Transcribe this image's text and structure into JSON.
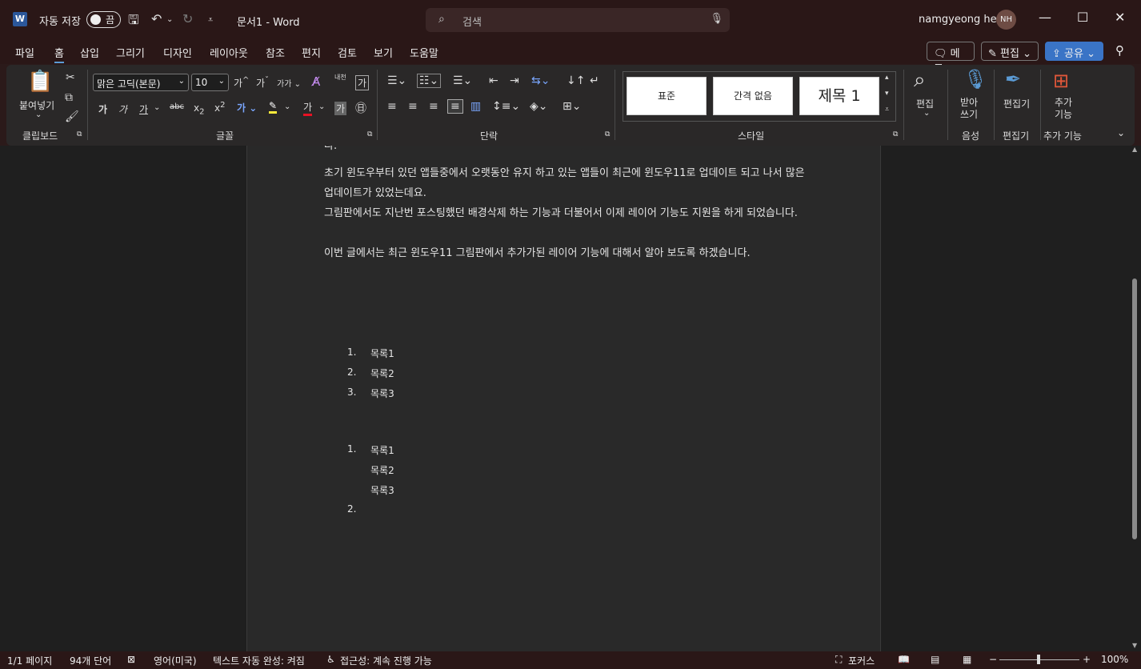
{
  "titlebar": {
    "autosave_label": "자동 저장",
    "autosave_toggle": "끔",
    "document_title": "문서1  -  Word",
    "search_placeholder": "검색",
    "user_name": "namgyeong heo",
    "user_initials": "NH"
  },
  "menu": {
    "items": [
      "파일",
      "홈",
      "삽입",
      "그리기",
      "디자인",
      "레이아웃",
      "참조",
      "편지",
      "검토",
      "보기",
      "도움말"
    ],
    "active": "홈",
    "memo_label": "메모",
    "edit_label": "편집",
    "share_label": "공유"
  },
  "ribbon": {
    "clipboard": {
      "paste_label": "붙여넣기",
      "group_label": "클립보드"
    },
    "font": {
      "font_name": "맑은 고딕(본문)",
      "font_size": "10",
      "group_label": "글꼴",
      "bold": "가",
      "italic": "가",
      "underline": "가",
      "strike": "가",
      "char_shade": "가"
    },
    "paragraph": {
      "group_label": "단락"
    },
    "styles": {
      "group_label": "스타일",
      "items": [
        "표준",
        "간격 없음",
        "제목 1"
      ]
    },
    "editing": {
      "label": "편집"
    },
    "voice": {
      "label": "받아\n쓰기",
      "group_label": "음성"
    },
    "editor": {
      "label": "편집기",
      "group_label": "편집기"
    },
    "addins": {
      "label": "추가\n기능",
      "group_label": "추가 기능"
    }
  },
  "document": {
    "top_fragment": "다.",
    "paragraphs": [
      "초기 윈도우부터 있던 앱들중에서 오랫동안 유지 하고 있는 앱들이 최근에 윈도우11로 업데이트 되고 나서 많은 업데이트가 있었는데요.",
      "그림판에서도 지난번 포스팅했던 배경삭제 하는 기능과 더불어서 이제 레이어 기능도 지원을 하게 되었습니다.",
      "이번 글에서는 최근 윈도우11 그림판에서 추가가된 레이어 기능에 대해서 알아 보도록 하겠습니다."
    ],
    "list1": [
      {
        "num": "1.",
        "text": "목록1"
      },
      {
        "num": "2.",
        "text": "목록2"
      },
      {
        "num": "3.",
        "text": "목록3"
      }
    ],
    "list2": [
      {
        "num": "1.",
        "text": "목록1"
      },
      {
        "num": "",
        "text": "목록2"
      },
      {
        "num": "",
        "text": "목록3"
      },
      {
        "num": "2.",
        "text": ""
      }
    ]
  },
  "status": {
    "page": "1/1 페이지",
    "words": "94개 단어",
    "language": "영어(미국)",
    "autocomplete": "텍스트 자동 완성: 켜짐",
    "accessibility": "접근성: 계속 진행 가능",
    "focus": "포커스",
    "zoom": "100%"
  }
}
